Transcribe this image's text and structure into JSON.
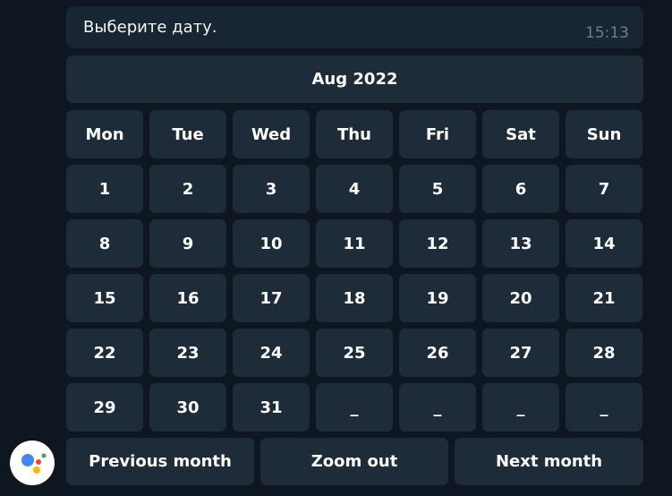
{
  "message": {
    "text": "Выберите дату.",
    "time": "15:13"
  },
  "calendar": {
    "month_label": "Aug 2022",
    "weekdays": [
      "Mon",
      "Tue",
      "Wed",
      "Thu",
      "Fri",
      "Sat",
      "Sun"
    ],
    "weeks": [
      [
        "1",
        "2",
        "3",
        "4",
        "5",
        "6",
        "7"
      ],
      [
        "8",
        "9",
        "10",
        "11",
        "12",
        "13",
        "14"
      ],
      [
        "15",
        "16",
        "17",
        "18",
        "19",
        "20",
        "21"
      ],
      [
        "22",
        "23",
        "24",
        "25",
        "26",
        "27",
        "28"
      ],
      [
        "29",
        "30",
        "31",
        "_",
        "_",
        "_",
        "_"
      ]
    ],
    "nav": {
      "previous_label": "Previous month",
      "zoom_label": "Zoom out",
      "next_label": "Next month"
    }
  },
  "avatar": {
    "icon": "google-assistant-icon",
    "colors": [
      "#4285f4",
      "#ea4335",
      "#fbbc05",
      "#34a853"
    ]
  },
  "colors": {
    "background": "#0e1621",
    "message_bubble": "#182533",
    "button": "#1e2c3a",
    "time_text": "#6d7f8f"
  }
}
